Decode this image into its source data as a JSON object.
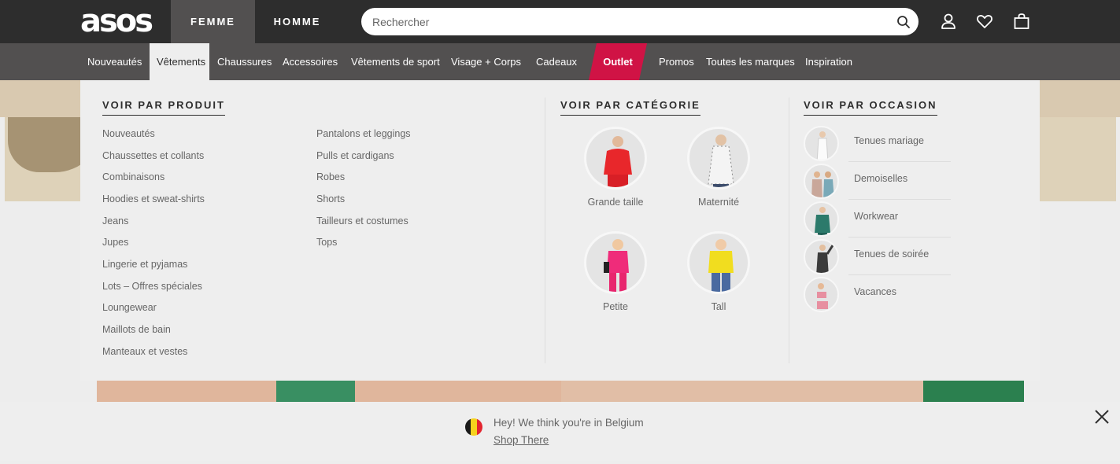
{
  "header": {
    "logo": "asos",
    "tabs": [
      {
        "label": "FEMME",
        "active": true
      },
      {
        "label": "HOMME",
        "active": false
      }
    ],
    "search": {
      "placeholder": "Rechercher",
      "value": ""
    },
    "icons": [
      "search-icon",
      "account-icon",
      "heart-icon",
      "bag-icon"
    ]
  },
  "nav": {
    "items": [
      {
        "label": "Nouveautés"
      },
      {
        "label": "Vêtements",
        "active": true
      },
      {
        "label": "Chaussures"
      },
      {
        "label": "Accessoires"
      },
      {
        "label": "Vêtements de sport"
      },
      {
        "label": "Visage + Corps"
      },
      {
        "label": "Cadeaux"
      },
      {
        "label": "Outlet",
        "highlight": true
      },
      {
        "label": "Promos"
      },
      {
        "label": "Toutes les marques"
      },
      {
        "label": "Inspiration"
      }
    ]
  },
  "menu": {
    "product": {
      "title": "VOIR PAR PRODUIT",
      "col1": [
        "Nouveautés",
        "Chaussettes et collants",
        "Combinaisons",
        "Hoodies et sweat-shirts",
        "Jeans",
        "Jupes",
        "Lingerie et pyjamas",
        "Lots – Offres spéciales",
        "Loungewear",
        "Maillots de bain",
        "Manteaux et vestes"
      ],
      "col2": [
        "Pantalons et leggings",
        "Pulls et cardigans",
        "Robes",
        "Shorts",
        "Tailleurs et costumes",
        "Tops"
      ]
    },
    "category": {
      "title": "VOIR PAR CATÉGORIE",
      "items": [
        "Grande taille",
        "Maternité",
        "Petite",
        "Tall"
      ]
    },
    "occasion": {
      "title": "VOIR PAR OCCASION",
      "items": [
        "Tenues mariage",
        "Demoiselles",
        "Workwear",
        "Tenues de soirée",
        "Vacances"
      ]
    }
  },
  "geo_notice": {
    "message": "Hey! We think you're in Belgium",
    "link": "Shop There",
    "flag_colors": [
      "#1a1a1a",
      "#f6d21d",
      "#e3242f"
    ],
    "close_icon": "close-icon"
  },
  "colors": {
    "header_bg": "#2d2d2d",
    "nav_bg": "#525050",
    "outlet_red": "#d01345",
    "menu_bg": "#eeeeee"
  }
}
